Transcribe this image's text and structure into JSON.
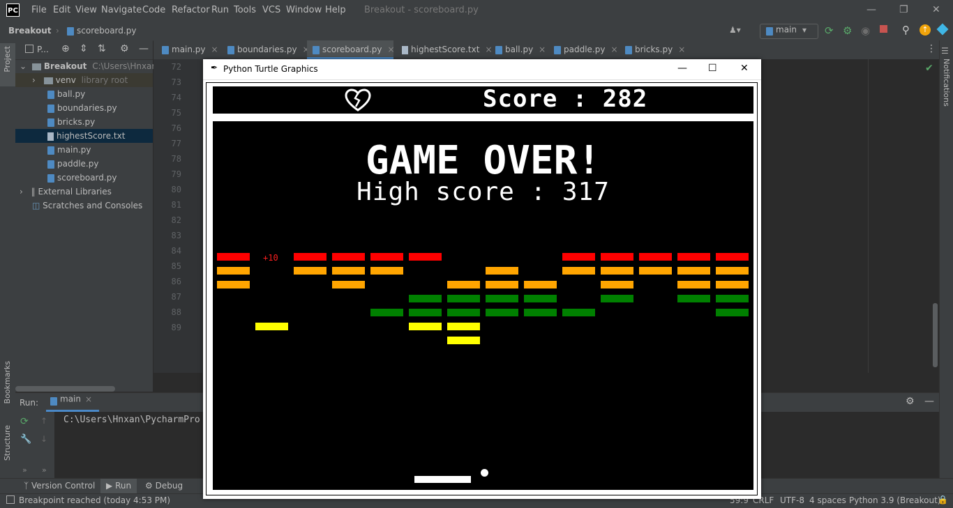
{
  "menubar": {
    "logo": "PC",
    "items": [
      "File",
      "Edit",
      "View",
      "Navigate",
      "Code",
      "Refactor",
      "Run",
      "Tools",
      "VCS",
      "Window",
      "Help"
    ],
    "window_title": "Breakout - scoreboard.py"
  },
  "navbar": {
    "project": "Breakout",
    "file": "scoreboard.py",
    "run_config": "main"
  },
  "project_panel": {
    "title": "P...",
    "tree": [
      {
        "label": "Breakout",
        "extra": "C:\\Users\\Hnxan\\P",
        "type": "root"
      },
      {
        "label": "venv",
        "extra": "library root",
        "type": "folder"
      },
      {
        "label": "ball.py",
        "type": "py"
      },
      {
        "label": "boundaries.py",
        "type": "py"
      },
      {
        "label": "bricks.py",
        "type": "py"
      },
      {
        "label": "highestScore.txt",
        "type": "txt",
        "selected": true
      },
      {
        "label": "main.py",
        "type": "py"
      },
      {
        "label": "paddle.py",
        "type": "py"
      },
      {
        "label": "scoreboard.py",
        "type": "py"
      },
      {
        "label": "External Libraries",
        "type": "lib"
      },
      {
        "label": "Scratches and Consoles",
        "type": "scratch"
      }
    ]
  },
  "tabs": [
    "main.py",
    "boundaries.py",
    "scoreboard.py",
    "highestScore.txt",
    "ball.py",
    "paddle.py",
    "bricks.py"
  ],
  "active_tab": "scoreboard.py",
  "line_numbers": [
    "72",
    "73",
    "74",
    "75",
    "76",
    "77",
    "78",
    "79",
    "80",
    "81",
    "82",
    "83",
    "84",
    "85",
    "86",
    "87",
    "88",
    "89"
  ],
  "side_labels": {
    "project": "Project",
    "bookmarks": "Bookmarks",
    "structure": "Structure",
    "notifications": "Notifications"
  },
  "run_panel": {
    "label": "Run:",
    "config": "main",
    "output": "C:\\Users\\Hnxan\\PycharmPro"
  },
  "bottom_tabs": [
    "Version Control",
    "Run",
    "Debug"
  ],
  "status": {
    "message": "Breakpoint reached (today 4:53 PM)",
    "position": "59:9",
    "line_sep": "CRLF",
    "encoding": "UTF-8",
    "indent": "4 spaces",
    "interpreter": "Python 3.9 (Breakout)"
  },
  "turtle": {
    "window_title": "Python Turtle Graphics",
    "score_text": "Score : 282",
    "game_over": "GAME OVER!",
    "high_score": "High score : 317",
    "bonus": "+10",
    "colors": {
      "red": "#ff0000",
      "orange": "#ffa500",
      "green": "#008000",
      "yellow": "#ffff00"
    },
    "brick_rows": [
      {
        "color": "red",
        "cols": [
          0,
          2,
          3,
          4,
          5,
          9,
          10,
          11,
          12,
          13
        ]
      },
      {
        "color": "orange",
        "cols": [
          0,
          2,
          3,
          4,
          7,
          9,
          10,
          11,
          12,
          13
        ]
      },
      {
        "color": "orange",
        "cols": [
          0,
          3,
          6,
          7,
          8,
          10,
          12,
          13
        ]
      },
      {
        "color": "green",
        "cols": [
          5,
          6,
          7,
          8,
          10,
          12,
          13
        ]
      },
      {
        "color": "green",
        "cols": [
          4,
          5,
          6,
          7,
          8,
          9,
          13
        ]
      },
      {
        "color": "yellow",
        "cols": [
          1,
          5,
          6
        ]
      },
      {
        "color": "yellow",
        "cols": [
          6
        ]
      }
    ]
  }
}
